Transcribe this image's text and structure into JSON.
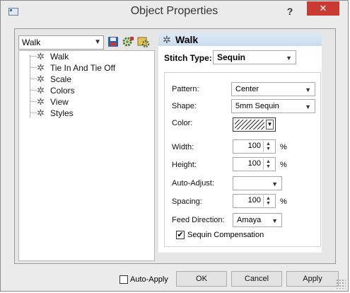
{
  "window": {
    "title": "Object Properties",
    "help_label": "?",
    "close_label": "✕"
  },
  "tree": {
    "combo_value": "Walk",
    "items": [
      {
        "label": "Walk"
      },
      {
        "label": "Tie In And Tie Off"
      },
      {
        "label": "Scale"
      },
      {
        "label": "Colors"
      },
      {
        "label": "View"
      },
      {
        "label": "Styles"
      }
    ]
  },
  "panel": {
    "header_title": "Walk",
    "stitch_type_label": "Stitch Type:",
    "stitch_type_value": "Sequin",
    "fields": {
      "pattern_label": "Pattern:",
      "pattern_value": "Center",
      "shape_label": "Shape:",
      "shape_value": "5mm Sequin",
      "color_label": "Color:",
      "width_label": "Width:",
      "width_value": "100",
      "height_label": "Height:",
      "height_value": "100",
      "auto_adjust_label": "Auto-Adjust:",
      "auto_adjust_value": "",
      "spacing_label": "Spacing:",
      "spacing_value": "100",
      "feed_direction_label": "Feed Direction:",
      "feed_direction_value": "Amaya",
      "percent_unit": "%",
      "sequin_compensation_label": "Sequin Compensation",
      "sequin_compensation_checked": true
    }
  },
  "footer": {
    "auto_apply_label": "Auto-Apply",
    "auto_apply_checked": false,
    "ok_label": "OK",
    "cancel_label": "Cancel",
    "apply_label": "Apply"
  },
  "colors": {
    "close_button": "#c83a32",
    "panel_header": "#c9dcef"
  }
}
